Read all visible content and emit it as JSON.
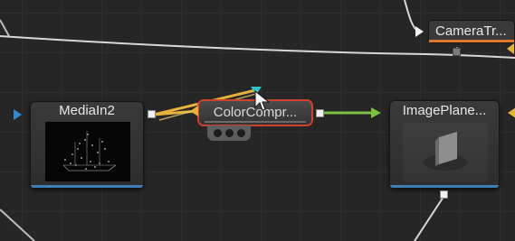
{
  "flow": {
    "nodes": {
      "camera_tracker": {
        "title": "CameraTr...",
        "underline_color": "#e07a2a"
      },
      "media_in": {
        "title": "MediaIn2",
        "underline_color": "#3d7fb6"
      },
      "color_compressor": {
        "title": "ColorCompr...",
        "selected_color": "#d0402e",
        "underline_color": "#5a5a5a"
      },
      "image_plane": {
        "title": "ImagePlane...",
        "underline_color": "#3d7fb6"
      }
    },
    "colors": {
      "connection_yellow": "#e7b23a",
      "connection_green": "#7cc142",
      "connection_white": "#d6d6d6",
      "input_blue": "#2e8ad6",
      "input_cyan": "#2ec2c9"
    },
    "icons": [
      "mouse-cursor-icon",
      "more-options-icon",
      "ship-thumbnail-icon",
      "plane-thumbnail-icon"
    ]
  }
}
